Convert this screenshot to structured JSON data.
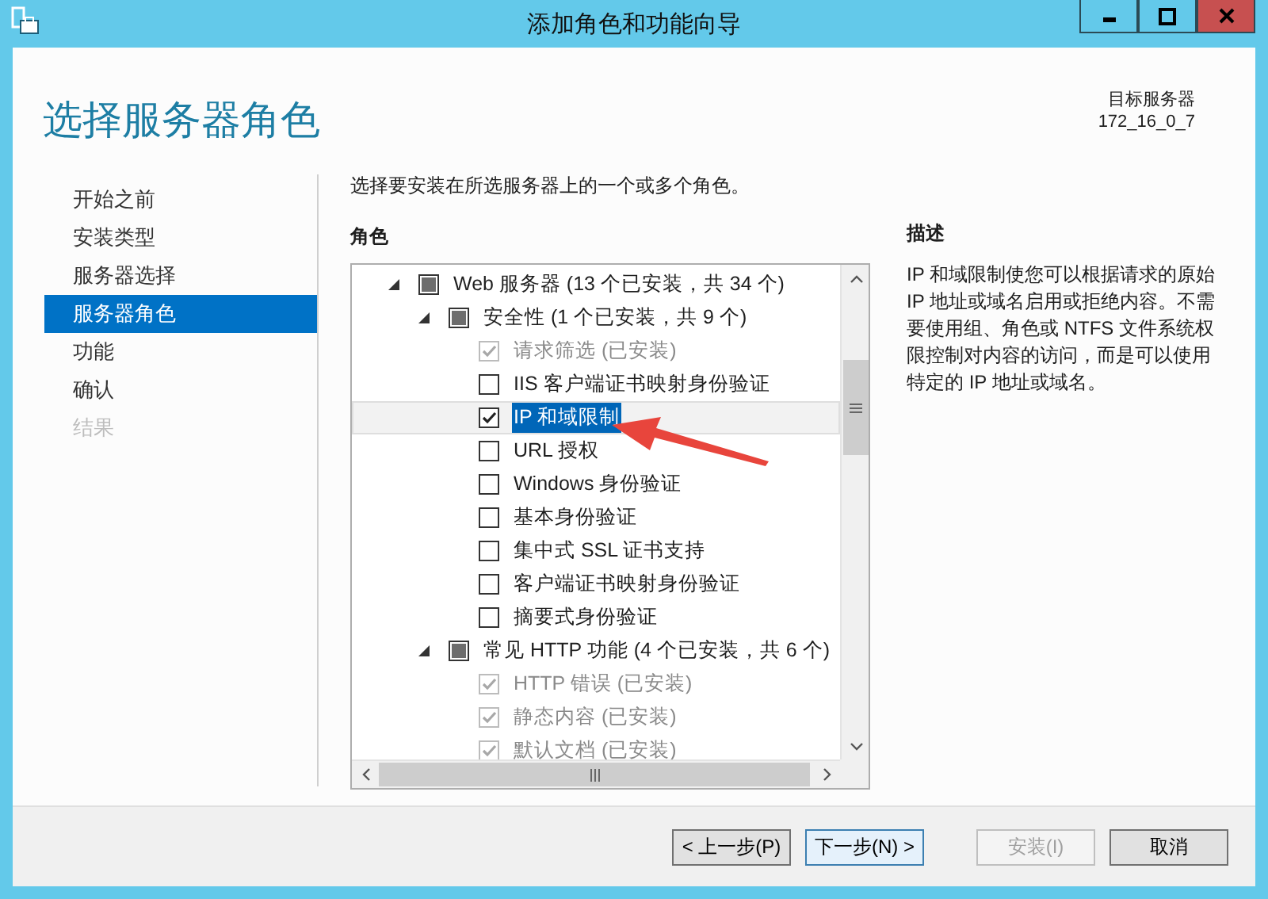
{
  "window": {
    "title": "添加角色和功能向导"
  },
  "header": {
    "title": "选择服务器角色",
    "target_label": "目标服务器",
    "target_value": "172_16_0_7"
  },
  "sidebar": {
    "items": [
      {
        "label": "开始之前",
        "selected": false,
        "disabled": false
      },
      {
        "label": "安装类型",
        "selected": false,
        "disabled": false
      },
      {
        "label": "服务器选择",
        "selected": false,
        "disabled": false
      },
      {
        "label": "服务器角色",
        "selected": true,
        "disabled": false
      },
      {
        "label": "功能",
        "selected": false,
        "disabled": false
      },
      {
        "label": "确认",
        "selected": false,
        "disabled": false
      },
      {
        "label": "结果",
        "selected": false,
        "disabled": true
      }
    ]
  },
  "instruction": "选择要安装在所选服务器上的一个或多个角色。",
  "roles": {
    "heading": "角色",
    "tree": [
      {
        "label": "Web 服务器 (13 个已安装，共 34 个)",
        "partial": true,
        "disabled": false,
        "selected": false,
        "expanded": true,
        "children": [
          {
            "label": "安全性 (1 个已安装，共 9 个)",
            "partial": true,
            "disabled": false,
            "selected": false,
            "expanded": true,
            "children": [
              {
                "label": "请求筛选 (已安装)",
                "checked": true,
                "disabled": true,
                "selected": false
              },
              {
                "label": "IIS 客户端证书映射身份验证",
                "checked": false,
                "disabled": false,
                "selected": false
              },
              {
                "label": "IP 和域限制",
                "checked": true,
                "disabled": false,
                "selected": true
              },
              {
                "label": "URL 授权",
                "checked": false,
                "disabled": false,
                "selected": false
              },
              {
                "label": "Windows 身份验证",
                "checked": false,
                "disabled": false,
                "selected": false
              },
              {
                "label": "基本身份验证",
                "checked": false,
                "disabled": false,
                "selected": false
              },
              {
                "label": "集中式 SSL 证书支持",
                "checked": false,
                "disabled": false,
                "selected": false
              },
              {
                "label": "客户端证书映射身份验证",
                "checked": false,
                "disabled": false,
                "selected": false
              },
              {
                "label": "摘要式身份验证",
                "checked": false,
                "disabled": false,
                "selected": false
              }
            ]
          },
          {
            "label": "常见 HTTP 功能 (4 个已安装，共 6 个)",
            "partial": true,
            "disabled": false,
            "selected": false,
            "expanded": true,
            "children": [
              {
                "label": "HTTP 错误 (已安装)",
                "checked": true,
                "disabled": true,
                "selected": false
              },
              {
                "label": "静态内容 (已安装)",
                "checked": true,
                "disabled": true,
                "selected": false
              },
              {
                "label": "默认文档 (已安装)",
                "checked": true,
                "disabled": true,
                "selected": false
              }
            ]
          }
        ]
      }
    ]
  },
  "description": {
    "heading": "描述",
    "text": "IP 和域限制使您可以根据请求的原始 IP 地址或域名启用或拒绝内容。不需要使用组、角色或 NTFS 文件系统权限控制对内容的访问，而是可以使用特定的 IP 地址或域名。"
  },
  "buttons": [
    {
      "label": "< 上一步(P)",
      "disabled": false,
      "focused": false
    },
    {
      "label": "下一步(N) >",
      "disabled": false,
      "focused": true
    },
    {
      "label": "安装(I)",
      "disabled": true,
      "focused": false
    },
    {
      "label": "取消",
      "disabled": false,
      "focused": false
    }
  ]
}
